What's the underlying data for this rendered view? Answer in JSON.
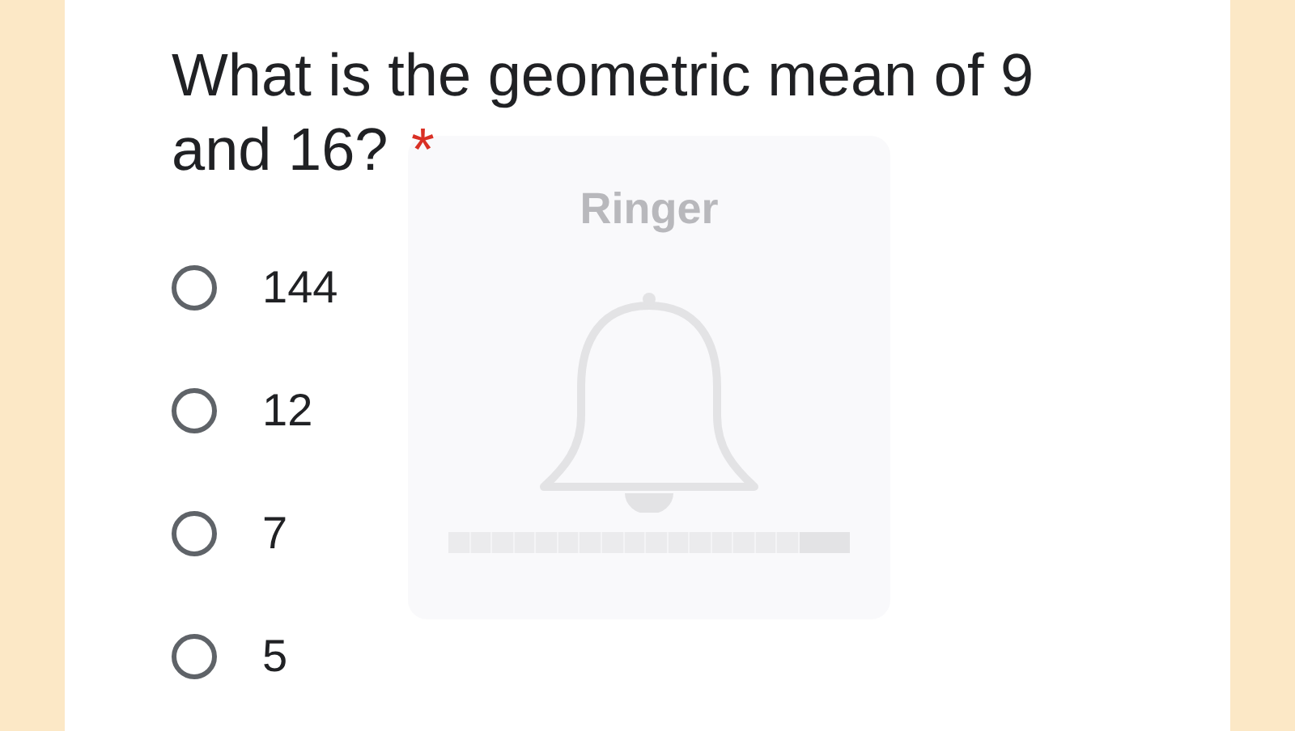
{
  "question": {
    "text": "What is the geometric mean of 9 and 16?",
    "required_mark": "*"
  },
  "options": [
    {
      "label": "144",
      "selected": false
    },
    {
      "label": "12",
      "selected": false
    },
    {
      "label": "7",
      "selected": false
    },
    {
      "label": "5",
      "selected": false
    }
  ],
  "volume_overlay": {
    "title": "Ringer",
    "level": 0.875
  }
}
